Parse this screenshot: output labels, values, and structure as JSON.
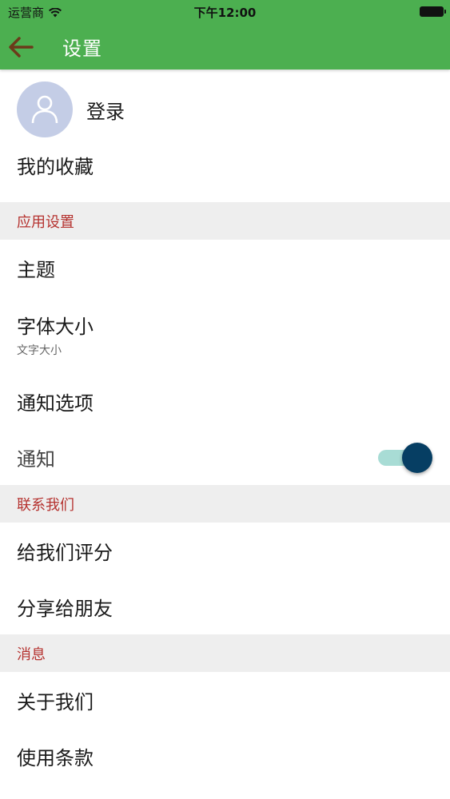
{
  "status_bar": {
    "carrier": "运营商",
    "time": "下午12:00"
  },
  "app_bar": {
    "title": "设置"
  },
  "account": {
    "login_label": "登录",
    "favorites_label": "我的收藏"
  },
  "sections": {
    "app_settings": {
      "header": "应用设置",
      "theme_label": "主题",
      "font_size_label": "字体大小",
      "font_size_value": "文字大小",
      "notification_options_label": "通知选项",
      "notification_label": "通知",
      "notification_enabled": true
    },
    "contact": {
      "header": "联系我们",
      "rate_label": "给我们评分",
      "share_label": "分享给朋友"
    },
    "info": {
      "header": "消息",
      "about_label": "关于我们",
      "terms_label": "使用条款"
    }
  },
  "colors": {
    "primary": "#4caf50",
    "section_text": "#b5322f",
    "toggle_thumb": "#063e63",
    "toggle_track": "#a8dcd5"
  }
}
